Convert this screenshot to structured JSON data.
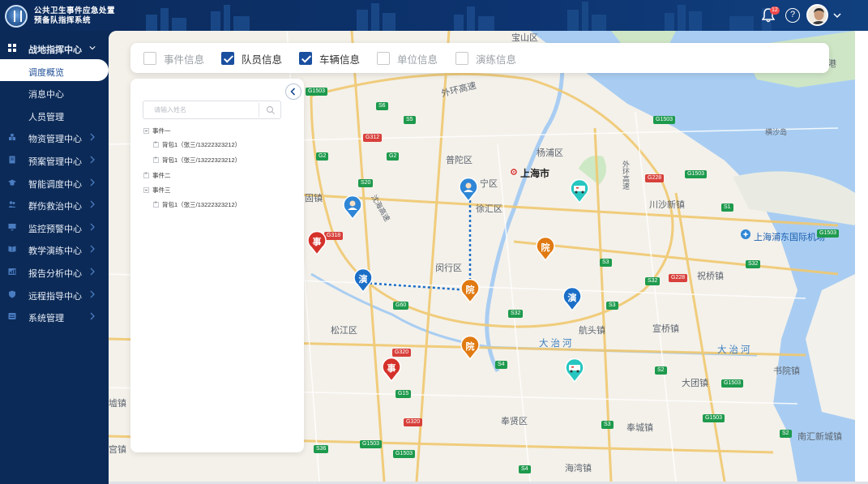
{
  "app": {
    "title_line1": "公共卫生事件应急处置",
    "title_line2": "预备队指挥系统",
    "notification_count": "12"
  },
  "sidebar": {
    "items": [
      {
        "label": "战地指挥中心",
        "icon": "grid-icon",
        "expanded": true
      },
      {
        "label": "调度概览",
        "active": true
      },
      {
        "label": "消息中心"
      },
      {
        "label": "人员管理"
      },
      {
        "label": "物资管理中心",
        "icon": "boxes-icon"
      },
      {
        "label": "预案管理中心",
        "icon": "document-icon"
      },
      {
        "label": "智能调度中心",
        "icon": "graduation-icon"
      },
      {
        "label": "群伤救治中心",
        "icon": "people-icon"
      },
      {
        "label": "监控预警中心",
        "icon": "monitor-icon"
      },
      {
        "label": "教学演练中心",
        "icon": "book-icon"
      },
      {
        "label": "报告分析中心",
        "icon": "report-icon"
      },
      {
        "label": "远程指导中心",
        "icon": "shield-icon"
      },
      {
        "label": "系统管理",
        "icon": "settings-icon"
      }
    ]
  },
  "filters": [
    {
      "label": "事件信息",
      "checked": false
    },
    {
      "label": "队员信息",
      "checked": true
    },
    {
      "label": "车辆信息",
      "checked": true
    },
    {
      "label": "单位信息",
      "checked": false
    },
    {
      "label": "演练信息",
      "checked": false
    }
  ],
  "tree": {
    "search_placeholder": "请输入姓名",
    "nodes": [
      {
        "label": "事件一",
        "level": 0
      },
      {
        "label": "背包1（张三/13222323212）",
        "level": 1
      },
      {
        "label": "背包1（张三/13222323212）",
        "level": 1
      },
      {
        "label": "事件二",
        "level": 0
      },
      {
        "label": "事件三",
        "level": 0
      },
      {
        "label": "背包1（张三/13222323212）",
        "level": 1
      }
    ]
  },
  "map": {
    "labels": [
      {
        "text": "宝山区"
      },
      {
        "text": "外环高速"
      },
      {
        "text": "普陀区"
      },
      {
        "text": "杨浦区"
      },
      {
        "text": "上海市"
      },
      {
        "text": "徐汇区"
      },
      {
        "text": "宁区"
      },
      {
        "text": "闵行区"
      },
      {
        "text": "松江区"
      },
      {
        "text": "航头镇"
      },
      {
        "text": "宣桥镇"
      },
      {
        "text": "大治河"
      },
      {
        "text": "大治河"
      },
      {
        "text": "大团镇"
      },
      {
        "text": "书院镇"
      },
      {
        "text": "奉贤区"
      },
      {
        "text": "奉城镇"
      },
      {
        "text": "海湾镇"
      },
      {
        "text": "南汇新城镇"
      },
      {
        "text": "川沙新镇"
      },
      {
        "text": "祝桥镇"
      },
      {
        "text": "上海浦东国际机场"
      },
      {
        "text": "横沙岛"
      },
      {
        "text": "固镇"
      },
      {
        "text": "沈海高速"
      },
      {
        "text": "外环高速"
      },
      {
        "text": "墟镇"
      },
      {
        "text": "宫镇"
      },
      {
        "text": "港"
      }
    ],
    "routes": [
      "G1503",
      "S6",
      "G1503",
      "S5",
      "G312",
      "G2",
      "G2",
      "S20",
      "G318",
      "G60",
      "G320",
      "G15",
      "G320",
      "S36",
      "G1503",
      "G1503",
      "S4",
      "S3",
      "S32",
      "S32",
      "S3",
      "G228",
      "S1",
      "S2",
      "G1503",
      "G1503",
      "S3",
      "G1503",
      "S4",
      "G228",
      "G1503",
      "S32",
      "S2"
    ],
    "markers": [
      {
        "type": "事",
        "kind": "incident"
      },
      {
        "type": "事",
        "kind": "incident"
      },
      {
        "type": "演",
        "kind": "drill"
      },
      {
        "type": "演",
        "kind": "drill"
      },
      {
        "type": "院",
        "kind": "hospital"
      },
      {
        "type": "院",
        "kind": "hospital"
      },
      {
        "type": "院",
        "kind": "hospital"
      }
    ],
    "colors": {
      "incident": "#d4312a",
      "drill": "#1b6fc7",
      "hospital": "#e07a12",
      "vehicle": "#27c6c0",
      "member": "#2f86d6"
    }
  }
}
